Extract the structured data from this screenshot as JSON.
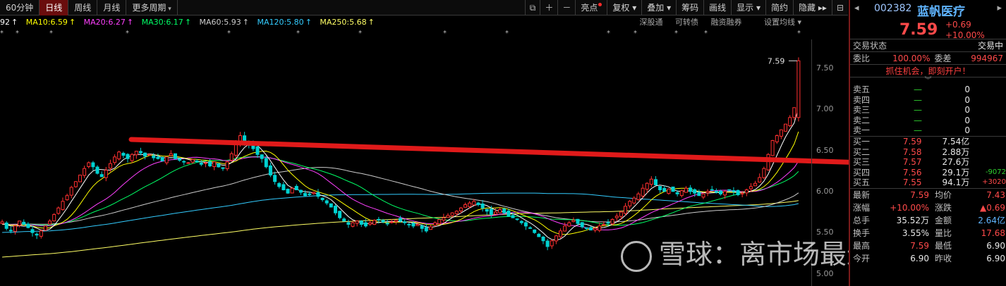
{
  "toolbar": {
    "tabs": [
      {
        "label": "60分钟",
        "active": false
      },
      {
        "label": "日线",
        "active": true
      },
      {
        "label": "周线",
        "active": false
      },
      {
        "label": "月线",
        "active": false
      },
      {
        "label": "更多周期",
        "active": false
      }
    ],
    "right_buttons": [
      "亮点",
      "复权",
      "叠加",
      "筹码",
      "画线",
      "显示",
      "简约",
      "隐藏"
    ],
    "icons": [
      "window-icon",
      "plus-icon",
      "minus-icon"
    ]
  },
  "ma_legend": [
    {
      "label": "92",
      "color": "#ffffff"
    },
    {
      "label": "MA10:6.59",
      "color": "#ffff00"
    },
    {
      "label": "MA20:6.27",
      "color": "#ff40ff"
    },
    {
      "label": "MA30:6.17",
      "color": "#00ff66"
    },
    {
      "label": "MA60:5.93",
      "color": "#cccccc"
    },
    {
      "label": "MA120:5.80",
      "color": "#33ccff"
    },
    {
      "label": "MA250:5.68",
      "color": "#ffff66"
    }
  ],
  "chart_tools": [
    "深股通",
    "可转债",
    "融资融券",
    "设置均线"
  ],
  "chart_data": {
    "type": "candlestick",
    "y_ticks": [
      "7.50",
      "7.00",
      "6.50",
      "6.00",
      "5.50",
      "5.00"
    ],
    "ylim": [
      4.85,
      7.85
    ],
    "last_price_label": "7.59",
    "closes": [
      5.63,
      5.55,
      5.52,
      5.58,
      5.64,
      5.6,
      5.56,
      5.5,
      5.47,
      5.52,
      5.58,
      5.64,
      5.72,
      5.8,
      5.88,
      5.95,
      6.05,
      6.12,
      6.2,
      6.28,
      6.35,
      6.3,
      6.22,
      6.18,
      6.26,
      6.34,
      6.42,
      6.48,
      6.44,
      6.4,
      6.45,
      6.49,
      6.47,
      6.43,
      6.45,
      6.41,
      6.4,
      6.37,
      6.42,
      6.46,
      6.4,
      6.38,
      6.36,
      6.35,
      6.39,
      6.37,
      6.33,
      6.35,
      6.31,
      6.36,
      6.3,
      6.28,
      6.36,
      6.46,
      6.58,
      6.68,
      6.6,
      6.56,
      6.52,
      6.45,
      6.4,
      6.3,
      6.2,
      6.12,
      6.06,
      6.02,
      5.98,
      6.04,
      6.02,
      5.99,
      5.95,
      5.96,
      5.99,
      5.94,
      5.9,
      5.86,
      5.81,
      5.74,
      5.68,
      5.64,
      5.6,
      5.62,
      5.64,
      5.6,
      5.58,
      5.62,
      5.65,
      5.66,
      5.63,
      5.61,
      5.63,
      5.65,
      5.64,
      5.62,
      5.6,
      5.58,
      5.6,
      5.55,
      5.52,
      5.57,
      5.62,
      5.66,
      5.68,
      5.71,
      5.74,
      5.76,
      5.8,
      5.84,
      5.86,
      5.88,
      5.84,
      5.8,
      5.76,
      5.72,
      5.75,
      5.78,
      5.74,
      5.7,
      5.68,
      5.66,
      5.62,
      5.58,
      5.55,
      5.5,
      5.45,
      5.4,
      5.33,
      5.4,
      5.46,
      5.52,
      5.58,
      5.62,
      5.65,
      5.61,
      5.57,
      5.55,
      5.53,
      5.55,
      5.58,
      5.6,
      5.62,
      5.66,
      5.7,
      5.75,
      5.82,
      5.88,
      5.92,
      5.97,
      6.04,
      6.1,
      6.15,
      6.08,
      6.02,
      6.0,
      6.03,
      6.0,
      5.97,
      6.01,
      6.04,
      6.0,
      5.98,
      5.95,
      5.97,
      6.0,
      6.02,
      5.99,
      5.97,
      6.0,
      6.02,
      6.0,
      5.96,
      5.98,
      6.02,
      6.06,
      6.1,
      6.17,
      6.28,
      6.45,
      6.62,
      6.68,
      6.75,
      6.82,
      6.9,
      7.02,
      7.59
    ],
    "ma_colors": {
      "ma5": "#ffffff",
      "ma10": "#ffff00",
      "ma20": "#ff40ff",
      "ma30": "#00ff66",
      "ma60": "#cccccc",
      "ma120": "#33ccff",
      "ma250": "#ffff66"
    },
    "up_color": "#ff3030",
    "down_color": "#00d2d2"
  },
  "panel": {
    "code": "002382",
    "name": "蓝帆医疗",
    "price": "7.59",
    "change": "+0.69",
    "change_pct": "+10.00%",
    "trade_status_label": "交易状态",
    "trade_status": "交易中",
    "weibi_label": "委比",
    "weibi": "100.00%",
    "weicha_label": "委差",
    "weicha": "994967",
    "banner": "抓住机会，即刻开户！",
    "asks": [
      {
        "label": "卖五",
        "price": "—",
        "vol": "0"
      },
      {
        "label": "卖四",
        "price": "—",
        "vol": "0"
      },
      {
        "label": "卖三",
        "price": "—",
        "vol": "0"
      },
      {
        "label": "卖二",
        "price": "—",
        "vol": "0"
      },
      {
        "label": "卖一",
        "price": "—",
        "vol": "0"
      }
    ],
    "bids": [
      {
        "label": "买一",
        "price": "7.59",
        "vol": "7.54亿",
        "extra": ""
      },
      {
        "label": "买二",
        "price": "7.58",
        "vol": "2.88万",
        "extra": ""
      },
      {
        "label": "买三",
        "price": "7.57",
        "vol": "27.6万",
        "extra": ""
      },
      {
        "label": "买四",
        "price": "7.56",
        "vol": "29.1万",
        "extra": "-9072"
      },
      {
        "label": "买五",
        "price": "7.55",
        "vol": "94.1万",
        "extra": "+3020"
      }
    ],
    "stats": [
      {
        "k": "最新",
        "v": "7.59",
        "k2": "均价",
        "v2": "7.43"
      },
      {
        "k": "涨幅",
        "v": "+10.00%",
        "k2": "涨跌",
        "v2": "▲0.69"
      },
      {
        "k": "总手",
        "v": "35.52万",
        "k2": "金额",
        "v2": "2.64亿"
      },
      {
        "k": "换手",
        "v": "3.55%",
        "k2": "量比",
        "v2": "17.68"
      },
      {
        "k": "最高",
        "v": "7.59",
        "k2": "最低",
        "v2": "6.90"
      },
      {
        "k": "今开",
        "v": "6.90",
        "k2": "昨收",
        "v2": "6.90"
      }
    ]
  },
  "watermark": "雪球：离市场最近的兔子"
}
